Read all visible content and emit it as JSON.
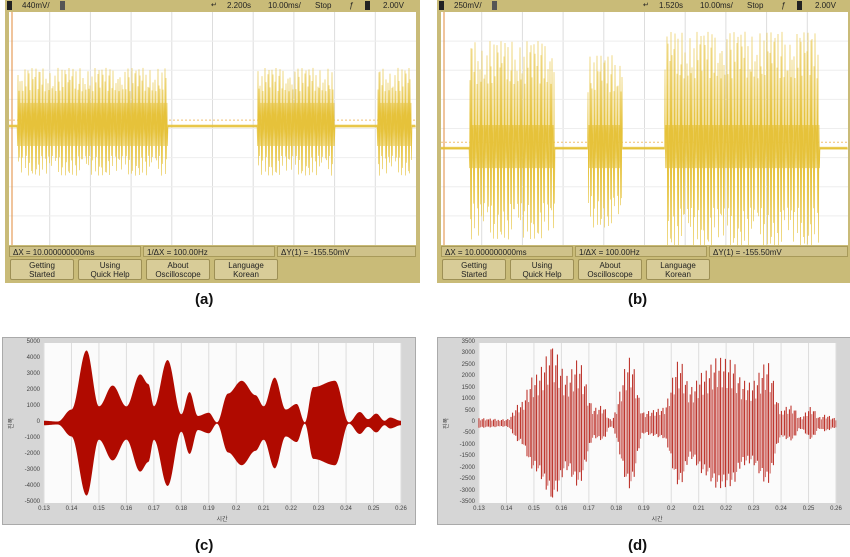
{
  "panels": [
    {
      "label": "(a)",
      "scope": {
        "channel_scale": "440mV/",
        "time_pos": "2.200s",
        "time_scale": "10.00ms/",
        "status": "Stop",
        "trigger_level": "2.00V",
        "measurements": [
          "ΔX = 10.000000000ms",
          "1/ΔX = 100.00Hz",
          "ΔY(1) = -155.50mV"
        ],
        "buttons": [
          [
            "Getting",
            "Started"
          ],
          [
            "Using",
            "Quick Help"
          ],
          [
            "About",
            "Oscilloscope"
          ],
          [
            "Language",
            "Korean"
          ]
        ]
      }
    },
    {
      "label": "(b)",
      "scope": {
        "channel_scale": "250mV/",
        "time_pos": "1.520s",
        "time_scale": "10.00ms/",
        "status": "Stop",
        "trigger_level": "2.00V",
        "measurements": [
          "ΔX = 10.000000000ms",
          "1/ΔX = 100.00Hz",
          "ΔY(1) = -155.50mV"
        ],
        "buttons": [
          [
            "Getting",
            "Started"
          ],
          [
            "Using",
            "Quick Help"
          ],
          [
            "About",
            "Oscilloscope"
          ],
          [
            "Language",
            "Korean"
          ]
        ]
      }
    },
    {
      "label": "(c)"
    },
    {
      "label": "(d)"
    }
  ],
  "colors": {
    "trace": "#e6c23a",
    "wave": "#b00a00",
    "scope_bg": "#c9bb78"
  },
  "chart_data": [
    {
      "type": "area",
      "panel": "(c)",
      "xlabel": "시간",
      "ylabel": "진폭",
      "xlim": [
        0.13,
        0.26
      ],
      "ylim": [
        -5000,
        5000
      ],
      "xticks": [
        "0.13",
        "0.14",
        "0.15",
        "0.16",
        "0.17",
        "0.18",
        "0.19",
        "0.2",
        "0.21",
        "0.22",
        "0.23",
        "0.24",
        "0.25",
        "0.26"
      ],
      "yticks": [
        "5000",
        "4000",
        "3000",
        "2000",
        "1000",
        "0",
        "-1000",
        "-2000",
        "-3000",
        "-4000",
        "-5000"
      ],
      "envelope_x": [
        0.13,
        0.135,
        0.14,
        0.1455,
        0.15,
        0.155,
        0.16,
        0.165,
        0.168,
        0.17,
        0.175,
        0.18,
        0.183,
        0.186,
        0.19,
        0.193,
        0.197,
        0.202,
        0.207,
        0.21,
        0.214,
        0.218,
        0.222,
        0.225,
        0.228,
        0.236,
        0.241,
        0.245,
        0.248,
        0.251,
        0.254,
        0.256,
        0.26
      ],
      "envelope_y": [
        100,
        50,
        800,
        4500,
        1000,
        2300,
        1000,
        3000,
        2400,
        1000,
        3900,
        500,
        1900,
        400,
        600,
        0,
        1800,
        2600,
        1700,
        1000,
        2800,
        800,
        1150,
        0,
        2200,
        2600,
        0,
        650,
        200,
        550,
        100,
        300,
        100
      ]
    },
    {
      "type": "line",
      "panel": "(d)",
      "xlabel": "시간",
      "ylabel": "진폭",
      "xlim": [
        0.13,
        0.26
      ],
      "ylim": [
        -3500,
        3500
      ],
      "xticks": [
        "0.13",
        "0.14",
        "0.15",
        "0.16",
        "0.17",
        "0.18",
        "0.19",
        "0.2",
        "0.21",
        "0.22",
        "0.23",
        "0.24",
        "0.25",
        "0.26"
      ],
      "yticks": [
        "3500",
        "3000",
        "2500",
        "2000",
        "1500",
        "1000",
        "500",
        "0",
        "-500",
        "-1000",
        "-1500",
        "-2000",
        "-2500",
        "-3000",
        "-3500"
      ],
      "envelope_x": [
        0.13,
        0.14,
        0.145,
        0.15,
        0.157,
        0.162,
        0.166,
        0.172,
        0.175,
        0.178,
        0.185,
        0.19,
        0.193,
        0.197,
        0.203,
        0.207,
        0.212,
        0.217,
        0.222,
        0.226,
        0.229,
        0.235,
        0.24,
        0.244,
        0.247,
        0.251,
        0.254,
        0.256,
        0.26
      ],
      "envelope_y": [
        150,
        100,
        800,
        2000,
        3200,
        2000,
        2700,
        600,
        700,
        100,
        2800,
        400,
        500,
        600,
        2700,
        1500,
        2200,
        2800,
        2700,
        1800,
        1700,
        2600,
        600,
        700,
        200,
        650,
        200,
        300,
        150
      ]
    }
  ]
}
